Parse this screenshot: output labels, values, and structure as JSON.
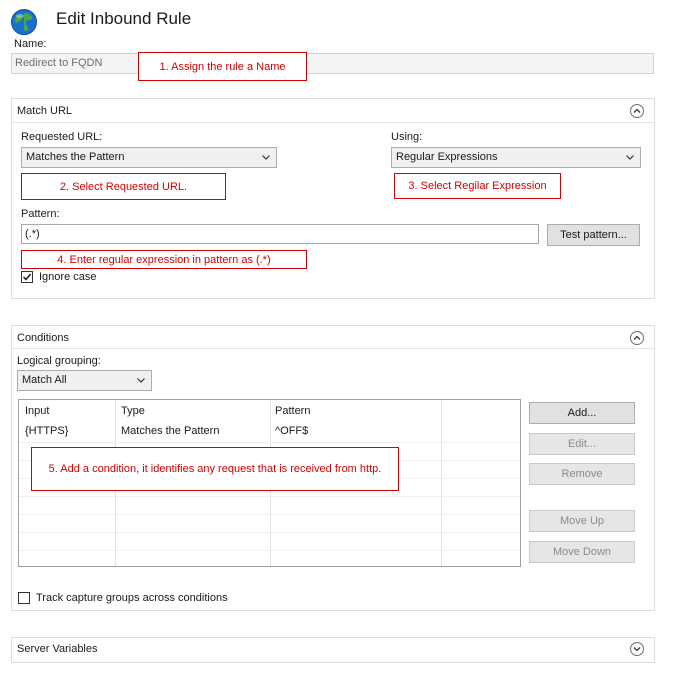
{
  "window": {
    "title": "Edit Inbound Rule"
  },
  "name": {
    "label": "Name:",
    "value": "Redirect to FQDN"
  },
  "match_url": {
    "header": "Match URL",
    "requested_url": {
      "label": "Requested URL:",
      "value": "Matches the Pattern"
    },
    "using": {
      "label": "Using:",
      "value": "Regular Expressions"
    },
    "pattern": {
      "label": "Pattern:",
      "value": "(.*)"
    },
    "test_pattern_button": "Test pattern...",
    "ignore_case": {
      "label": "Ignore case",
      "checked": true
    }
  },
  "conditions": {
    "header": "Conditions",
    "logical_grouping": {
      "label": "Logical grouping:",
      "value": "Match All"
    },
    "columns": [
      "Input",
      "Type",
      "Pattern"
    ],
    "rows": [
      {
        "input": "{HTTPS}",
        "type": "Matches the Pattern",
        "pattern": "^OFF$"
      }
    ],
    "buttons": {
      "add": "Add...",
      "edit": "Edit...",
      "remove": "Remove",
      "move_up": "Move Up",
      "move_down": "Move Down"
    },
    "track_capture": {
      "label": "Track capture groups across conditions",
      "checked": false
    }
  },
  "server_variables": {
    "header": "Server Variables"
  },
  "annotations": {
    "a1": "1. Assign the rule a Name",
    "a2": "2. Select Requested URL.",
    "a3": "3. Select Regilar Expression",
    "a4": "4. Enter regular expression in pattern as (.*)",
    "a5": "5. Add a condition, it identifies any request that is received from http."
  },
  "icons": {
    "app": "globe-icon",
    "collapse": "chevron-up-circle-icon",
    "expand": "chevron-down-circle-icon",
    "dropdown": "chevron-down-icon",
    "check": "checkmark-icon"
  },
  "colors": {
    "annotation": "#d40000"
  }
}
